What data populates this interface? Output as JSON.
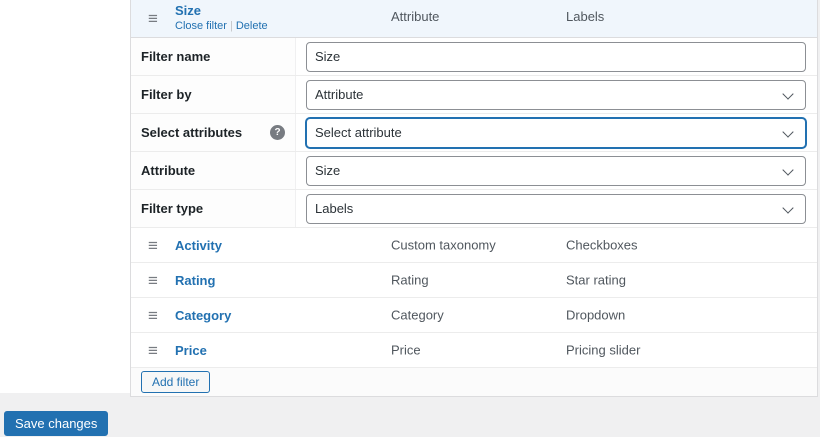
{
  "buttons": {
    "save_changes": "Save changes",
    "add_filter": "Add filter"
  },
  "icons": {
    "drag_handle": "≡",
    "help": "?"
  },
  "colors": {
    "accent": "#2271b1",
    "selected_row_bg": "#f0f6fc",
    "page_bg": "#f0f0f1"
  },
  "filter_table": {
    "header": {
      "name": "Size",
      "close_filter": "Close filter",
      "separator": "|",
      "delete": "Delete",
      "col_attribute": "Attribute",
      "col_labels": "Labels"
    },
    "form": {
      "fields": [
        {
          "label": "Filter name",
          "type": "text",
          "value": "Size"
        },
        {
          "label": "Filter by",
          "type": "select",
          "value": "Attribute"
        },
        {
          "label": "Select attributes",
          "type": "select",
          "value": "Select attribute",
          "has_help": true,
          "focused": true
        },
        {
          "label": "Attribute",
          "type": "select",
          "value": "Size"
        },
        {
          "label": "Filter type",
          "type": "select",
          "value": "Labels"
        }
      ]
    },
    "rows": [
      {
        "name": "Activity",
        "attribute": "Custom taxonomy",
        "type": "Checkboxes"
      },
      {
        "name": "Rating",
        "attribute": "Rating",
        "type": "Star rating"
      },
      {
        "name": "Category",
        "attribute": "Category",
        "type": "Dropdown"
      },
      {
        "name": "Price",
        "attribute": "Price",
        "type": "Pricing slider"
      }
    ]
  }
}
